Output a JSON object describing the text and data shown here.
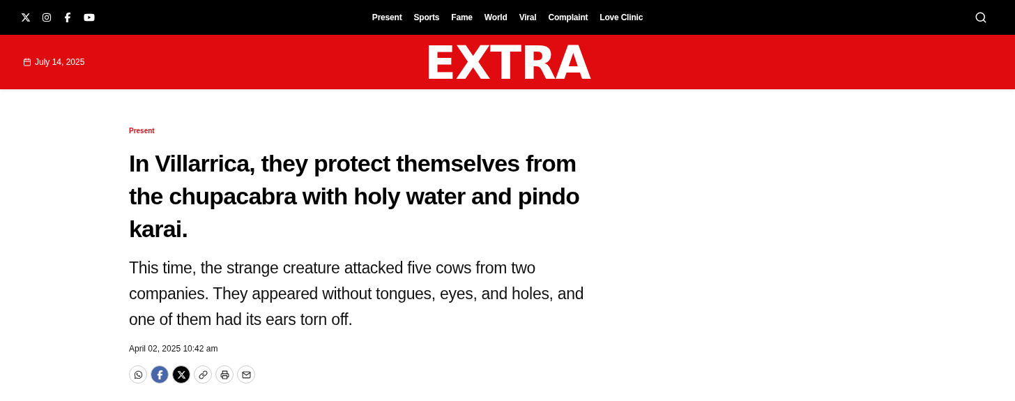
{
  "top_bar": {
    "social": [
      {
        "kind": "x"
      },
      {
        "kind": "instagram"
      },
      {
        "kind": "facebook"
      },
      {
        "kind": "youtube"
      }
    ],
    "nav": [
      "Present",
      "Sports",
      "Fame",
      "World",
      "Viral",
      "Complaint",
      "Love Clinic"
    ]
  },
  "header": {
    "date": "July 14, 2025",
    "logo": "EXTRA"
  },
  "article": {
    "category": "Present",
    "title": "In Villarrica, they protect themselves from the chupacabra with holy water and pindo karai.",
    "summary": "This time, the strange creature attacked five cows from two companies. They appeared without tongues, eyes, and holes, and one of them had its ears torn off.",
    "published": "April 02, 2025 10:42 am",
    "share": [
      {
        "kind": "whatsapp"
      },
      {
        "kind": "facebook"
      },
      {
        "kind": "x"
      },
      {
        "kind": "link"
      },
      {
        "kind": "print"
      },
      {
        "kind": "email"
      }
    ]
  }
}
